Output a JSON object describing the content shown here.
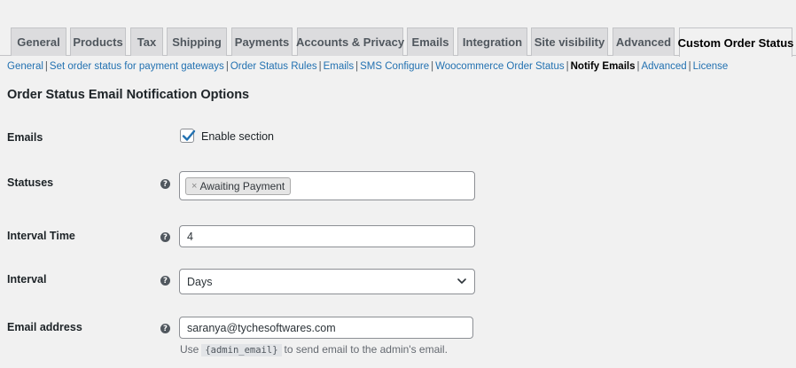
{
  "tabs": [
    {
      "label": "General"
    },
    {
      "label": "Products"
    },
    {
      "label": "Tax"
    },
    {
      "label": "Shipping"
    },
    {
      "label": "Payments"
    },
    {
      "label": "Accounts & Privacy"
    },
    {
      "label": "Emails"
    },
    {
      "label": "Integration"
    },
    {
      "label": "Site visibility"
    },
    {
      "label": "Advanced"
    },
    {
      "label": "Custom Order Status"
    }
  ],
  "active_tab": "Custom Order Status",
  "subnav": [
    {
      "label": "General"
    },
    {
      "label": "Set order status for payment gateways"
    },
    {
      "label": "Order Status Rules"
    },
    {
      "label": "Emails"
    },
    {
      "label": "SMS Configure"
    },
    {
      "label": "Woocommerce Order Status"
    },
    {
      "label": "Notify Emails"
    },
    {
      "label": "Advanced"
    },
    {
      "label": "License"
    }
  ],
  "subnav_current": "Notify Emails",
  "section_title": "Order Status Email Notification Options",
  "emails": {
    "label": "Emails",
    "checkbox_label": "Enable section",
    "checked": true
  },
  "statuses": {
    "label": "Statuses",
    "tag_remove": "×",
    "selected": "Awaiting Payment"
  },
  "interval_time": {
    "label": "Interval Time",
    "value": "4"
  },
  "interval": {
    "label": "Interval",
    "value": "Days"
  },
  "email_address": {
    "label": "Email address",
    "value": "saranya@tychesoftwares.com",
    "desc_before": "Use",
    "desc_code": "{admin_email}",
    "desc_after": "to send email to the admin's email."
  },
  "help_glyph": "?",
  "colors": {
    "link": "#2271b1",
    "checkbox_check": "#2271b1",
    "tab_bg": "#dcdcde",
    "page_bg": "#f1f1f1"
  }
}
